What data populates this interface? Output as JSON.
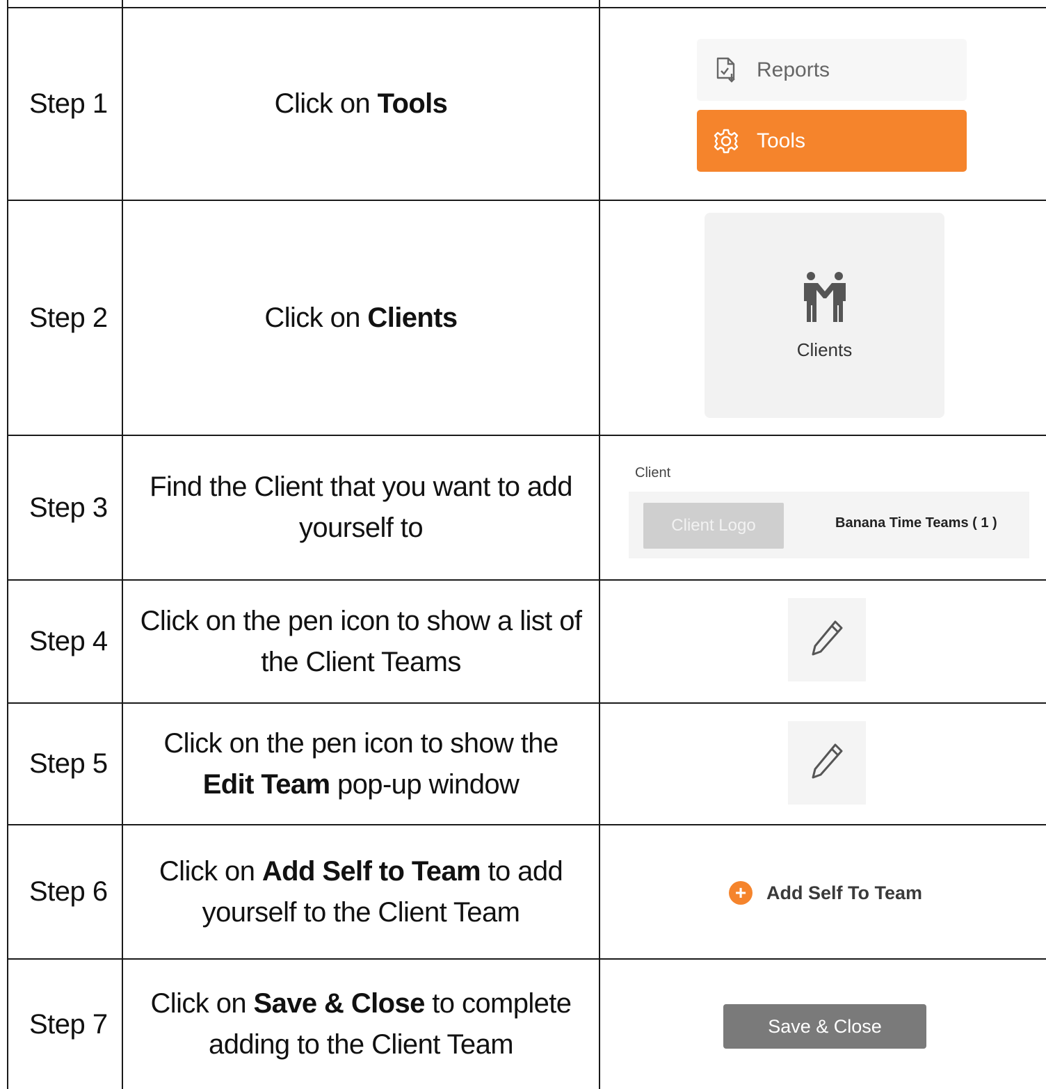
{
  "steps": [
    {
      "label": "Step 1",
      "desc_parts": [
        "Click on ",
        "Tools",
        ""
      ]
    },
    {
      "label": "Step 2",
      "desc_parts": [
        "Click on ",
        "Clients",
        ""
      ]
    },
    {
      "label": "Step 3",
      "desc": "Find the Client that you want to add yourself to"
    },
    {
      "label": "Step 4",
      "desc": "Click on the pen icon to show a list of the Client Teams"
    },
    {
      "label": "Step 5",
      "desc_parts": [
        "Click on the pen icon to show the ",
        "Edit Team",
        " pop-up window"
      ]
    },
    {
      "label": "Step 6",
      "desc_parts": [
        "Click on ",
        "Add Self to Team",
        " to add yourself to the Client Team"
      ]
    },
    {
      "label": "Step 7",
      "desc_parts": [
        "Click on ",
        "Save & Close",
        " to complete adding to the Client Team"
      ]
    }
  ],
  "menu": {
    "reports_label": "Reports",
    "reports_icon": "report-download-icon",
    "tools_label": "Tools",
    "tools_icon": "gear-icon"
  },
  "clients_card": {
    "label": "Clients",
    "icon": "people-icon"
  },
  "client_row": {
    "caption": "Client",
    "logo_placeholder": "Client Logo",
    "team_name": "Banana Time Teams ( 1 )"
  },
  "add_self": {
    "label": "Add Self To Team",
    "icon": "plus-circle-icon"
  },
  "save": {
    "label": "Save & Close"
  },
  "colors": {
    "accent": "#f5842c",
    "grey_button": "#7a7a7a",
    "panel": "#f4f4f4"
  }
}
